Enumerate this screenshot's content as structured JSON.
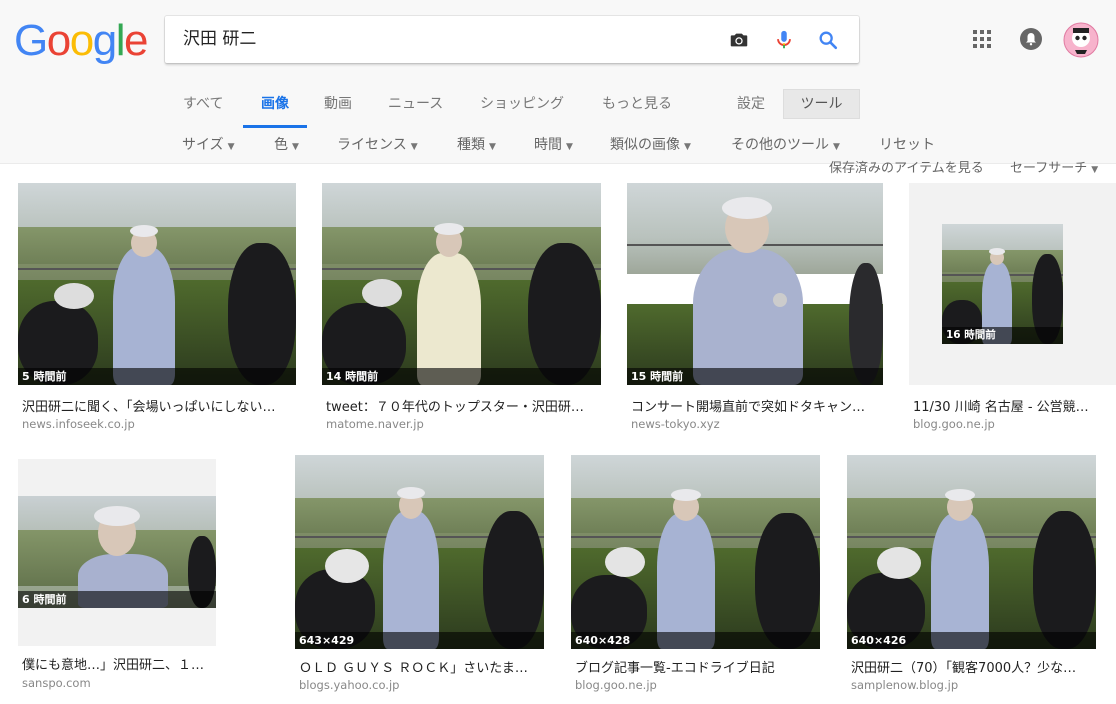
{
  "logo": "Google",
  "search": {
    "query": "沢田 研二"
  },
  "tabs": [
    "すべて",
    "画像",
    "動画",
    "ニュース",
    "ショッピング",
    "もっと見る"
  ],
  "active_tab": "画像",
  "settings_label": "設定",
  "tools_label": "ツール",
  "filters": [
    "サイズ",
    "色",
    "ライセンス",
    "種類",
    "時間",
    "類似の画像",
    "その他のツール",
    "リセット"
  ],
  "saved_items": "保存済みのアイテムを見る",
  "safe_search": "セーフサーチ",
  "results": [
    {
      "overlay": "5 時間前",
      "title": "沢田研二に聞く、「会場いっぱいにしない…",
      "site": "news.infoseek.co.jp"
    },
    {
      "overlay": "14 時間前",
      "title": "tweet：７０年代のトップスター・沢田研…",
      "site": "matome.naver.jp"
    },
    {
      "overlay": "15 時間前",
      "title": "コンサート開場直前で突如ドタキャン…",
      "site": "news-tokyo.xyz"
    },
    {
      "overlay": "16 時間前",
      "title": "11/30 川崎 名古屋 - 公営競…",
      "site": "blog.goo.ne.jp"
    },
    {
      "overlay": "6 時間前",
      "title": "僕にも意地…」沢田研二、１…",
      "site": "sanspo.com"
    },
    {
      "overlay": "643×429",
      "title": "ＯＬＤ ＧＵＹＳ ＲＯＣＫ」さいたま…",
      "site": "blogs.yahoo.co.jp"
    },
    {
      "overlay": "640×428",
      "title": "ブログ記事一覧-エコドライブ日記",
      "site": "blog.goo.ne.jp"
    },
    {
      "overlay": "640×426",
      "title": "沢田研二（70）「観客7000人？少な…",
      "site": "samplenow.blog.jp"
    }
  ],
  "colors": {
    "google_blue": "#4285F4",
    "google_red": "#EA4335",
    "google_yellow": "#FBBC05",
    "google_green": "#34A853",
    "accent": "#1a73e8"
  }
}
